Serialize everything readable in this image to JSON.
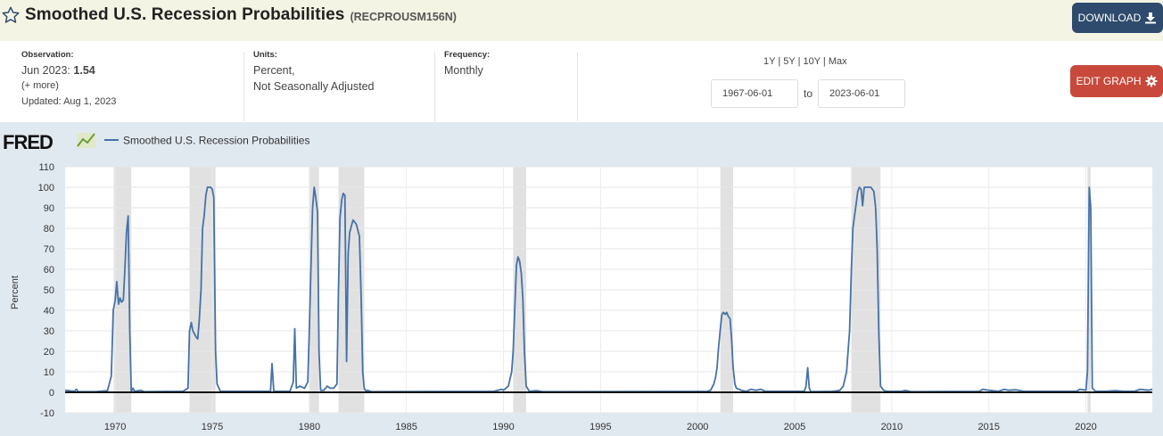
{
  "header": {
    "title": "Smoothed U.S. Recession Probabilities",
    "series_id": "(RECPROUSM156N)",
    "download_label": "DOWNLOAD"
  },
  "meta": {
    "observation_label": "Observation:",
    "observation_date": "Jun 2023:",
    "observation_value": "1.54",
    "more": "(+ more)",
    "updated": "Updated: Aug 1, 2023",
    "units_label": "Units:",
    "units_line1": "Percent,",
    "units_line2": "Not Seasonally Adjusted",
    "frequency_label": "Frequency:",
    "frequency_value": "Monthly"
  },
  "range": {
    "options": [
      "1Y",
      "5Y",
      "10Y",
      "Max"
    ],
    "start": "1967-06-01",
    "to": "to",
    "end": "2023-06-01"
  },
  "edit_label": "EDIT GRAPH",
  "colors": {
    "series": "#4572a7",
    "recession": "#e1e1e1",
    "download": "#2e4a6d",
    "edit": "#c8493b",
    "chart_bg": "#e1e9f0"
  },
  "chart_data": {
    "type": "line",
    "logo": "FRED",
    "legend": "Smoothed U.S. Recession Probabilities",
    "ylabel": "Percent",
    "ylim": [
      -10,
      110
    ],
    "yticks": [
      -10,
      0,
      10,
      20,
      30,
      40,
      50,
      60,
      70,
      80,
      90,
      100,
      110
    ],
    "xlim": [
      1967.42,
      2023.42
    ],
    "xticks": [
      1970,
      1975,
      1980,
      1985,
      1990,
      1995,
      2000,
      2005,
      2010,
      2015,
      2020
    ],
    "recessions": [
      [
        1969.92,
        1970.83
      ],
      [
        1973.83,
        1975.17
      ],
      [
        1980.0,
        1980.5
      ],
      [
        1981.5,
        1982.83
      ],
      [
        1990.5,
        1991.17
      ],
      [
        2001.17,
        2001.83
      ],
      [
        2007.92,
        2009.42
      ],
      [
        2020.08,
        2020.25
      ]
    ],
    "series": [
      {
        "name": "Smoothed U.S. Recession Probabilities",
        "points": [
          [
            1967.42,
            1.0
          ],
          [
            1967.9,
            0.5
          ],
          [
            1968.0,
            1.5
          ],
          [
            1968.1,
            0.3
          ],
          [
            1969.0,
            0.3
          ],
          [
            1969.6,
            0.8
          ],
          [
            1969.8,
            8.0
          ],
          [
            1969.9,
            40
          ],
          [
            1970.0,
            45
          ],
          [
            1970.08,
            54
          ],
          [
            1970.17,
            43
          ],
          [
            1970.25,
            46
          ],
          [
            1970.33,
            44
          ],
          [
            1970.42,
            45
          ],
          [
            1970.5,
            60
          ],
          [
            1970.58,
            78
          ],
          [
            1970.67,
            86
          ],
          [
            1970.75,
            30
          ],
          [
            1970.83,
            0.5
          ],
          [
            1970.92,
            2.0
          ],
          [
            1971.0,
            0.5
          ],
          [
            1971.3,
            1.0
          ],
          [
            1971.5,
            0.3
          ],
          [
            1973.5,
            0.5
          ],
          [
            1973.75,
            2
          ],
          [
            1973.83,
            30
          ],
          [
            1973.92,
            34
          ],
          [
            1974.0,
            30
          ],
          [
            1974.17,
            27
          ],
          [
            1974.25,
            26
          ],
          [
            1974.33,
            35
          ],
          [
            1974.42,
            50
          ],
          [
            1974.5,
            80
          ],
          [
            1974.58,
            86
          ],
          [
            1974.67,
            96
          ],
          [
            1974.75,
            100
          ],
          [
            1974.92,
            100
          ],
          [
            1975.0,
            99
          ],
          [
            1975.08,
            95
          ],
          [
            1975.17,
            20
          ],
          [
            1975.25,
            4
          ],
          [
            1975.42,
            0.5
          ],
          [
            1978.0,
            0.5
          ],
          [
            1978.08,
            14
          ],
          [
            1978.17,
            0.5
          ],
          [
            1979.0,
            0.5
          ],
          [
            1979.17,
            5
          ],
          [
            1979.25,
            31
          ],
          [
            1979.33,
            2
          ],
          [
            1979.5,
            3
          ],
          [
            1979.75,
            2
          ],
          [
            1979.92,
            5
          ],
          [
            1980.0,
            30
          ],
          [
            1980.08,
            60
          ],
          [
            1980.17,
            90
          ],
          [
            1980.25,
            100
          ],
          [
            1980.33,
            95
          ],
          [
            1980.42,
            88
          ],
          [
            1980.5,
            20
          ],
          [
            1980.58,
            1
          ],
          [
            1980.75,
            1
          ],
          [
            1980.92,
            3
          ],
          [
            1981.08,
            2
          ],
          [
            1981.25,
            2
          ],
          [
            1981.42,
            4
          ],
          [
            1981.5,
            50
          ],
          [
            1981.58,
            85
          ],
          [
            1981.67,
            94
          ],
          [
            1981.75,
            97
          ],
          [
            1981.83,
            96
          ],
          [
            1981.92,
            15
          ],
          [
            1982.0,
            68
          ],
          [
            1982.08,
            78
          ],
          [
            1982.25,
            84
          ],
          [
            1982.42,
            82
          ],
          [
            1982.58,
            76
          ],
          [
            1982.67,
            45
          ],
          [
            1982.75,
            10
          ],
          [
            1982.83,
            2
          ],
          [
            1982.92,
            0.5
          ],
          [
            1983.0,
            1
          ],
          [
            1983.2,
            0.3
          ],
          [
            1989.5,
            0.5
          ],
          [
            1989.7,
            1
          ],
          [
            1989.9,
            1.5
          ],
          [
            1990.0,
            1
          ],
          [
            1990.25,
            3
          ],
          [
            1990.42,
            10
          ],
          [
            1990.5,
            20
          ],
          [
            1990.58,
            40
          ],
          [
            1990.67,
            62
          ],
          [
            1990.75,
            66
          ],
          [
            1990.83,
            64
          ],
          [
            1990.92,
            58
          ],
          [
            1991.0,
            45
          ],
          [
            1991.08,
            20
          ],
          [
            1991.17,
            3
          ],
          [
            1991.33,
            0.5
          ],
          [
            1991.7,
            0.8
          ],
          [
            1992.0,
            0.3
          ],
          [
            2000.5,
            0.5
          ],
          [
            2000.67,
            1
          ],
          [
            2000.83,
            4
          ],
          [
            2000.92,
            7
          ],
          [
            2001.0,
            12
          ],
          [
            2001.08,
            22
          ],
          [
            2001.17,
            31
          ],
          [
            2001.25,
            38
          ],
          [
            2001.33,
            39
          ],
          [
            2001.42,
            38
          ],
          [
            2001.5,
            39
          ],
          [
            2001.58,
            37
          ],
          [
            2001.67,
            36
          ],
          [
            2001.75,
            26
          ],
          [
            2001.83,
            12
          ],
          [
            2001.92,
            4
          ],
          [
            2002.0,
            2
          ],
          [
            2002.25,
            1
          ],
          [
            2002.5,
            0.5
          ],
          [
            2002.75,
            1.5
          ],
          [
            2003.0,
            1
          ],
          [
            2003.25,
            1.5
          ],
          [
            2003.5,
            0.5
          ],
          [
            2005.5,
            0.5
          ],
          [
            2005.58,
            3
          ],
          [
            2005.67,
            12
          ],
          [
            2005.75,
            2
          ],
          [
            2005.83,
            0.3
          ],
          [
            2007.0,
            0.5
          ],
          [
            2007.33,
            1
          ],
          [
            2007.5,
            3
          ],
          [
            2007.67,
            10
          ],
          [
            2007.83,
            30
          ],
          [
            2007.92,
            60
          ],
          [
            2008.0,
            80
          ],
          [
            2008.08,
            86
          ],
          [
            2008.17,
            92
          ],
          [
            2008.25,
            98
          ],
          [
            2008.33,
            100
          ],
          [
            2008.42,
            99
          ],
          [
            2008.5,
            91
          ],
          [
            2008.58,
            100
          ],
          [
            2008.75,
            100
          ],
          [
            2008.92,
            100
          ],
          [
            2009.0,
            99
          ],
          [
            2009.08,
            98
          ],
          [
            2009.17,
            90
          ],
          [
            2009.25,
            70
          ],
          [
            2009.33,
            30
          ],
          [
            2009.42,
            3
          ],
          [
            2009.58,
            1
          ],
          [
            2009.75,
            0.5
          ],
          [
            2010.5,
            0.5
          ],
          [
            2010.7,
            0.9
          ],
          [
            2011.0,
            0.3
          ],
          [
            2014.5,
            0.5
          ],
          [
            2014.7,
            1.5
          ],
          [
            2015.0,
            1
          ],
          [
            2015.5,
            0.5
          ],
          [
            2015.8,
            1.5
          ],
          [
            2016.0,
            1
          ],
          [
            2016.4,
            1.2
          ],
          [
            2016.8,
            0.5
          ],
          [
            2019.5,
            0.5
          ],
          [
            2019.7,
            1.5
          ],
          [
            2020.0,
            1
          ],
          [
            2020.08,
            10
          ],
          [
            2020.17,
            100
          ],
          [
            2020.25,
            90
          ],
          [
            2020.33,
            2
          ],
          [
            2020.5,
            0.5
          ],
          [
            2021.0,
            0.5
          ],
          [
            2021.5,
            0.8
          ],
          [
            2022.0,
            0.5
          ],
          [
            2022.5,
            0.5
          ],
          [
            2022.8,
            1.5
          ],
          [
            2023.0,
            1.2
          ],
          [
            2023.25,
            1.0
          ],
          [
            2023.42,
            1.54
          ]
        ]
      }
    ]
  }
}
